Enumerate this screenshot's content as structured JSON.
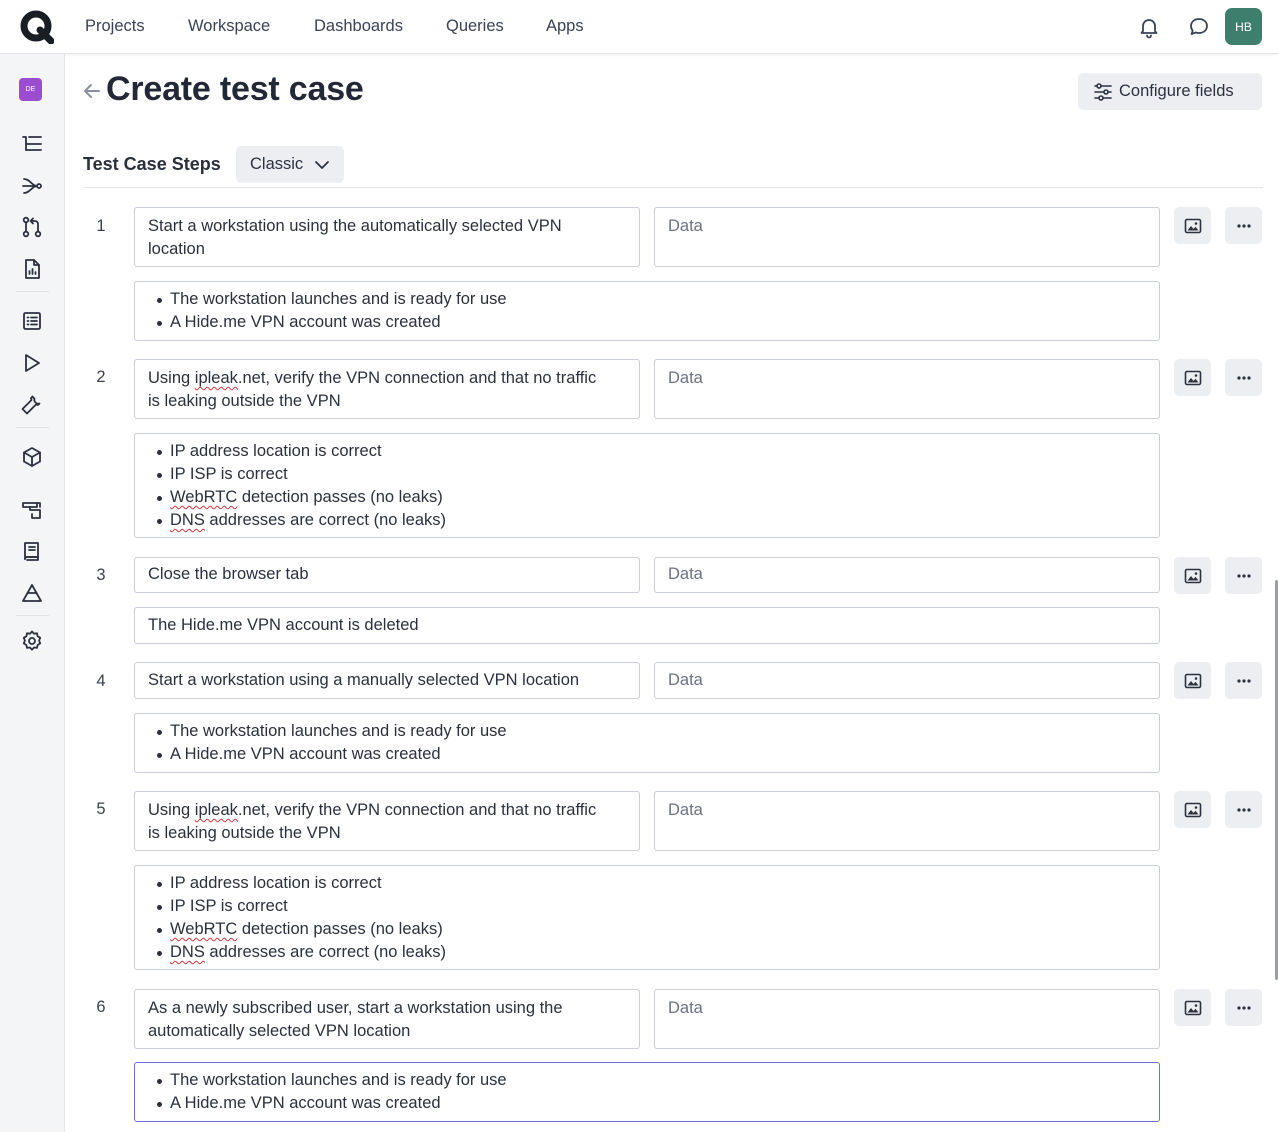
{
  "nav": {
    "items": [
      "Projects",
      "Workspace",
      "Dashboards",
      "Queries",
      "Apps"
    ],
    "user_initials": "HB"
  },
  "sidebar": {
    "project_badge": "DE",
    "icons": [
      "requirements-icon",
      "workflow-icon",
      "pull-request-icon",
      "report-icon",
      "test-cases-icon",
      "test-runs-icon",
      "tools-icon",
      "package-icon",
      "environment-icon",
      "book-icon",
      "milestone-icon",
      "settings-icon"
    ]
  },
  "header": {
    "title": "Create test case",
    "configure_label": "Configure fields"
  },
  "steps_section": {
    "label": "Test Case Steps",
    "mode": "Classic",
    "data_placeholder": "Data"
  },
  "steps": [
    {
      "number": "1",
      "action": [
        "Start a workstation using the automatically selected VPN",
        "location"
      ],
      "results": [
        "The workstation launches and is ready for use",
        "A Hide.me VPN account was created"
      ]
    },
    {
      "number": "2",
      "action": [
        "Using ipleak.net, verify the VPN connection and that no traffic",
        "is leaking outside the VPN"
      ],
      "results": [
        "IP address location is correct",
        "IP ISP is correct",
        "WebRTC detection passes (no leaks)",
        "DNS addresses are correct (no leaks)"
      ]
    },
    {
      "number": "3",
      "action": [
        "Close the browser tab"
      ],
      "result_text": "The Hide.me VPN account is deleted"
    },
    {
      "number": "4",
      "action": [
        "Start a workstation using a manually selected VPN location"
      ],
      "results": [
        "The workstation launches and is ready for use",
        "A Hide.me VPN account was created"
      ]
    },
    {
      "number": "5",
      "action": [
        "Using ipleak.net, verify the VPN connection and that no traffic",
        "is leaking outside the VPN"
      ],
      "results": [
        "IP address location is correct",
        "IP ISP is correct",
        "WebRTC detection passes (no leaks)",
        "DNS addresses are correct (no leaks)"
      ]
    },
    {
      "number": "6",
      "action": [
        "As a newly subscribed user, start a workstation using the",
        "automatically selected VPN location"
      ],
      "results": [
        "The workstation launches and is ready for use",
        "A Hide.me VPN account was created"
      ]
    }
  ],
  "colors": {
    "avatar_user": "#3d7f6c",
    "avatar_project": "#9c4cd1",
    "focus_border": "#6a74d8",
    "spellcheck": "#d4363e"
  }
}
